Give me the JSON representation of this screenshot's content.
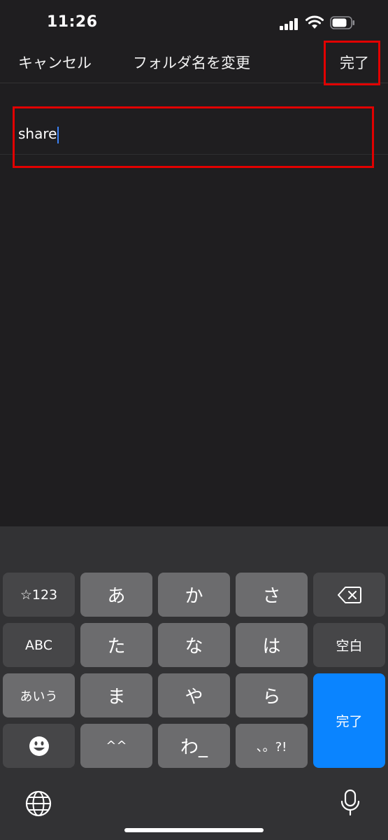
{
  "status_bar": {
    "time": "11:26"
  },
  "nav": {
    "cancel_label": "キャンセル",
    "title": "フォルダ名を変更",
    "done_label": "完了"
  },
  "field": {
    "value": "share"
  },
  "keyboard": {
    "rows": [
      [
        "☆123",
        "あ",
        "か",
        "さ",
        ""
      ],
      [
        "ABC",
        "た",
        "な",
        "は",
        "空白"
      ],
      [
        "あいう",
        "ま",
        "や",
        "ら",
        "完了"
      ],
      [
        "",
        "^^",
        "わ_",
        "、。?!"
      ]
    ],
    "icons": {
      "delete": "delete-icon",
      "emoji": "emoji-icon",
      "globe": "globe-icon",
      "mic": "microphone-icon"
    },
    "accent_color": "#0a84ff"
  },
  "highlight_color": "#e10000"
}
